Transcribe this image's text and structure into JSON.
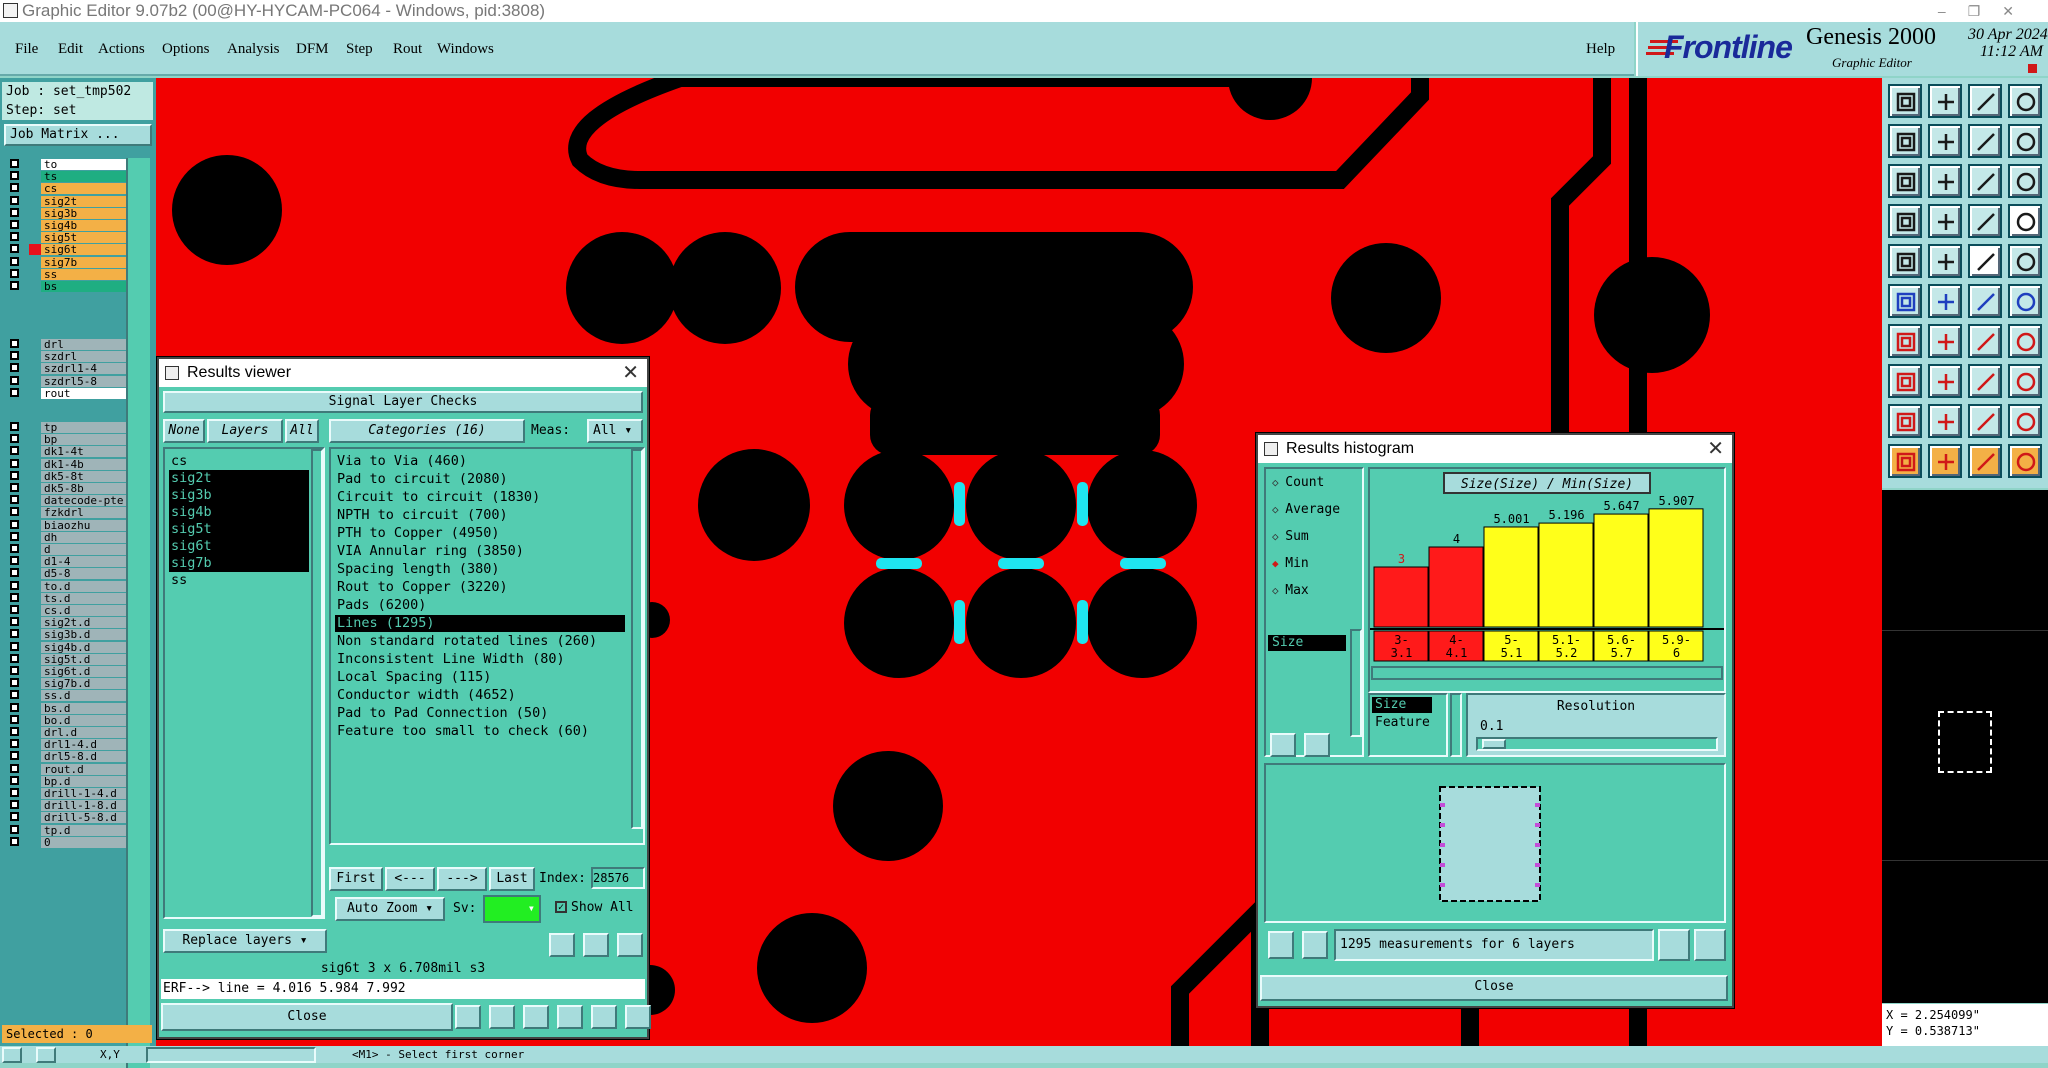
{
  "window_title": "Graphic Editor 9.07b2 (00@HY-HYCAM-PC064 - Windows, pid:3808)",
  "window_controls": [
    "–",
    "❐",
    "✕"
  ],
  "menu": {
    "items": [
      "File",
      "Edit",
      "Actions",
      "Options",
      "Analysis",
      "DFM",
      "Step",
      "Rout",
      "Windows"
    ],
    "help": "Help"
  },
  "brand": {
    "logo": "Frontline",
    "product": "Genesis 2000",
    "subtitle": "Graphic Editor",
    "date": "30 Apr 2024",
    "time": "11:12 AM"
  },
  "left_panel": {
    "job_label": "Job : set_tmp502",
    "step_label": "Step: set",
    "job_matrix": "Job Matrix ...",
    "layers_group1": [
      {
        "name": "to",
        "color": "#ffffff",
        "cell": "#40a0a0"
      },
      {
        "name": "ts",
        "color": "#1fae82",
        "cell": "#40a0a0"
      },
      {
        "name": "cs",
        "color": "#f3b046",
        "cell": "#40a0a0"
      },
      {
        "name": "sig2t",
        "color": "#f3b046",
        "cell": "#40a0a0"
      },
      {
        "name": "sig3b",
        "color": "#f3b046",
        "cell": "#40a0a0"
      },
      {
        "name": "sig4b",
        "color": "#f3b046",
        "cell": "#40a0a0"
      },
      {
        "name": "sig5t",
        "color": "#f3b046",
        "cell": "#40a0a0"
      },
      {
        "name": "sig6t",
        "color": "#f3b046",
        "cell": "#e8101a"
      },
      {
        "name": "sig7b",
        "color": "#f3b046",
        "cell": "#40a0a0"
      },
      {
        "name": "ss",
        "color": "#f3b046",
        "cell": "#40a0a0"
      },
      {
        "name": "bs",
        "color": "#1fae82",
        "cell": "#40a0a0"
      }
    ],
    "layers_group2": [
      {
        "name": "drl",
        "color": "#9fb4b8",
        "cell": "#40a0a0"
      },
      {
        "name": "szdrl",
        "color": "#9fb4b8",
        "cell": "#40a0a0"
      },
      {
        "name": "szdrl1-4",
        "color": "#9fb4b8",
        "cell": "#40a0a0"
      },
      {
        "name": "szdrl5-8",
        "color": "#9fb4b8",
        "cell": "#40a0a0"
      },
      {
        "name": "rout",
        "color": "#ffffff",
        "cell": "#40a0a0"
      }
    ],
    "layers_group3": [
      "tp",
      "bp",
      "dk1-4t",
      "dk1-4b",
      "dk5-8t",
      "dk5-8b",
      "datecode-pte",
      "fzkdrl",
      "biaozhu",
      "dh",
      "d",
      "d1-4",
      "d5-8",
      "to.d",
      "ts.d",
      "cs.d",
      "sig2t.d",
      "sig3b.d",
      "sig4b.d",
      "sig5t.d",
      "sig6t.d",
      "sig7b.d",
      "ss.d",
      "bs.d",
      "bo.d",
      "drl.d",
      "drl1-4.d",
      "drl5-8.d",
      "rout.d",
      "bp.d",
      "drill-1-4.d",
      "drill-1-8.d",
      "drill-5-8.d",
      "tp.d",
      "0"
    ],
    "selected": "Selected : 0"
  },
  "results_viewer": {
    "title": "Results viewer",
    "header": "Signal Layer Checks",
    "none_btn": "None",
    "layers_btn": "Layers",
    "all_btn": "All",
    "categories_label": "Categories (16)",
    "meas_label": "Meas:",
    "meas_value": "All",
    "layers": [
      "cs",
      "sig2t",
      "sig3b",
      "sig4b",
      "sig5t",
      "sig6t",
      "sig7b",
      "ss"
    ],
    "selected_layers": [
      1,
      2,
      3,
      4,
      5,
      6
    ],
    "categories": [
      "Via to Via (460)",
      "Pad to circuit (2080)",
      "Circuit to circuit (1830)",
      "NPTH to circuit (700)",
      "PTH to Copper (4950)",
      "VIA Annular ring (3850)",
      "Spacing length (380)",
      "Rout to Copper (3220)",
      "Pads (6200)",
      "Lines (1295)",
      "Non standard rotated lines (260)",
      "Inconsistent Line Width (80)",
      "Local Spacing (115)",
      "Conductor width (4652)",
      "Pad to Pad Connection (50)",
      "Feature too small to check (60)"
    ],
    "selected_category": 9,
    "nav": {
      "first": "First",
      "prev": "<---",
      "next": "--->",
      "last": "Last",
      "index_label": "Index:",
      "index_value": "28576"
    },
    "auto_zoom": "Auto Zoom",
    "sv_label": "Sv:",
    "show_all": "Show All",
    "replace_layers": "Replace layers",
    "info_line": "sig6t 3 x 6.708mil   s3",
    "erf_line": "ERF--> line = 4.016 5.984 7.992",
    "close": "Close"
  },
  "histogram": {
    "title": "Results histogram",
    "options": [
      "Count",
      "Average",
      "Sum",
      "Min",
      "Max"
    ],
    "selected_option": "Min",
    "size_item": "Size",
    "chart_title": "Size(Size) / Min(Size)",
    "size_label": "Size",
    "feature_label": "Feature",
    "resolution_label": "Resolution",
    "resolution_value": "0.1",
    "measurements": "1295 measurements for 6 layers",
    "close": "Close"
  },
  "chart_data": {
    "type": "bar",
    "categories": [
      "3-3.1",
      "4-4.1",
      "5-5.1",
      "5.1-5.2",
      "5.6-5.7",
      "5.9-6"
    ],
    "values": [
      3,
      4,
      5.001,
      5.196,
      5.647,
      5.907
    ],
    "value_labels": [
      "3",
      "4",
      "5.001",
      "5.196",
      "5.647",
      "5.907"
    ],
    "bin_labels": [
      [
        "3-",
        "3.1"
      ],
      [
        "4-",
        "4.1"
      ],
      [
        "5-",
        "5.1"
      ],
      [
        "5.1-",
        "5.2"
      ],
      [
        "5.6-",
        "5.7"
      ],
      [
        "5.9-",
        "6"
      ]
    ],
    "colors": [
      "#ff1a1a",
      "#ff1a1a",
      "#ffff1a",
      "#ffff1a",
      "#ffff1a",
      "#ffff1a"
    ],
    "ylim": [
      0,
      6.2
    ],
    "title": "Size(Size) / Min(Size)"
  },
  "coords": {
    "x": "X = 2.254099\"",
    "y": "Y = 0.538713\""
  },
  "status": {
    "prompt": "<M1> - Select first corner",
    "xy": "X,Y"
  },
  "colors": {
    "copper": "#f20000",
    "highlight": "#1fe5f0",
    "panel": "#54ccb0",
    "toolbar": "#a7dcdc"
  }
}
